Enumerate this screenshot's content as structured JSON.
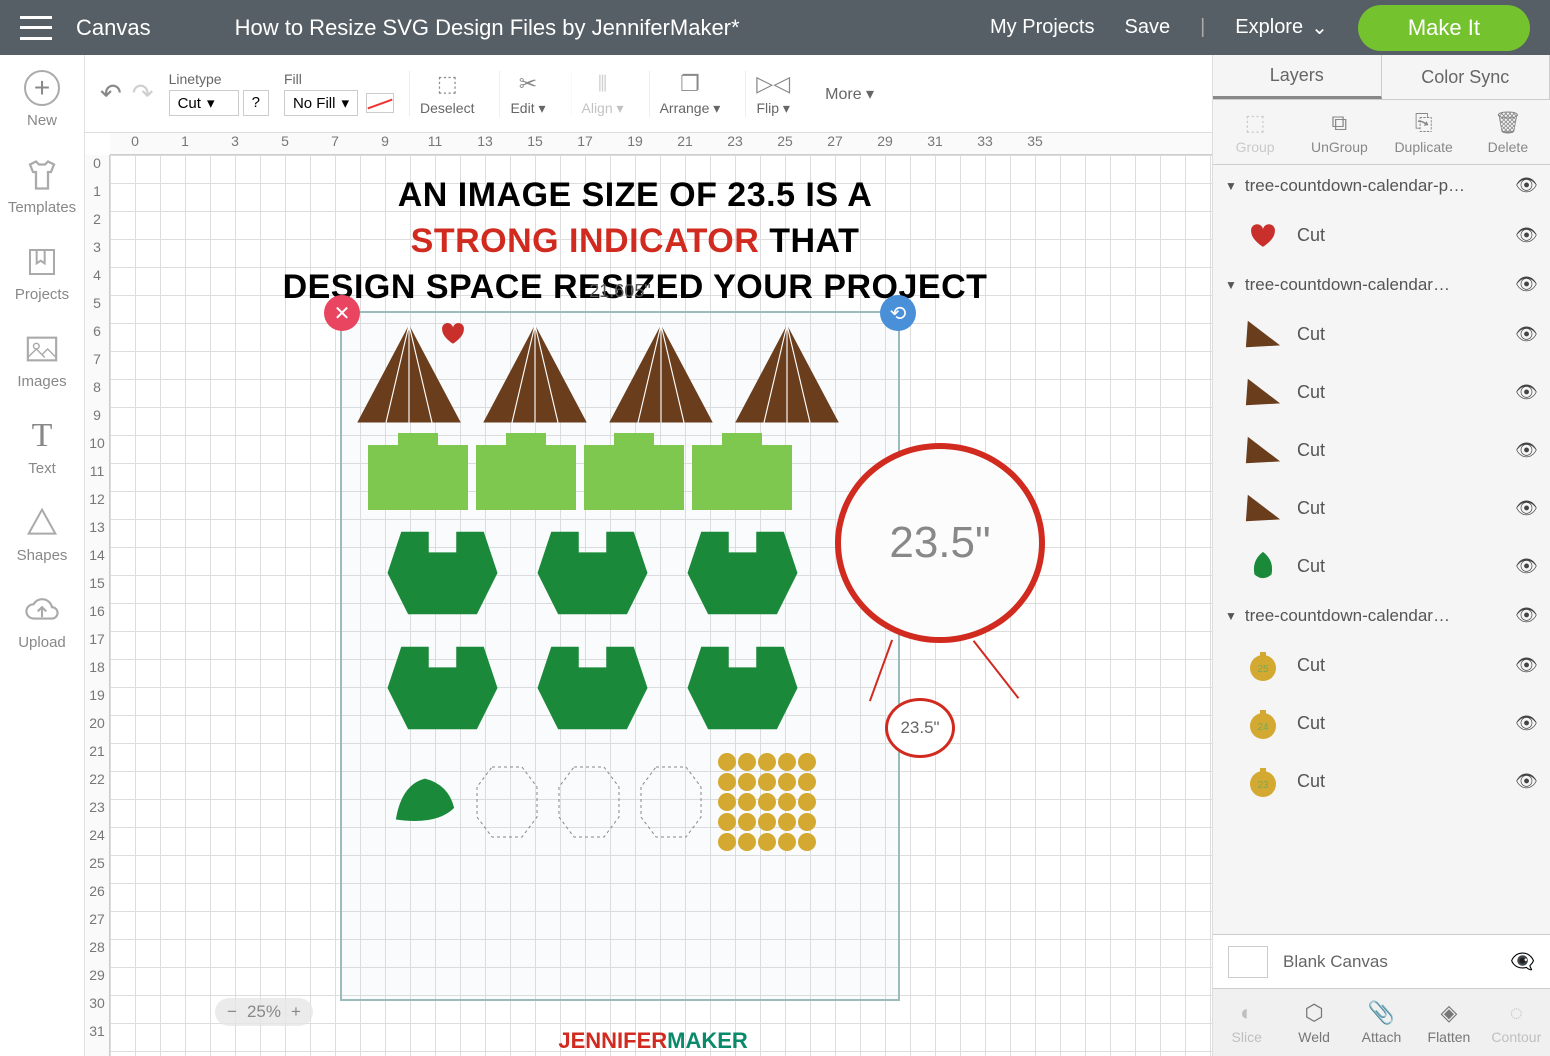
{
  "topbar": {
    "canvas": "Canvas",
    "title": "How to Resize SVG Design Files by JenniferMaker*",
    "myProjects": "My Projects",
    "save": "Save",
    "explore": "Explore",
    "makeIt": "Make It"
  },
  "leftTools": {
    "new": "New",
    "templates": "Templates",
    "projects": "Projects",
    "images": "Images",
    "text": "Text",
    "shapes": "Shapes",
    "upload": "Upload"
  },
  "toolbar": {
    "linetypeLabel": "Linetype",
    "linetype": "Cut",
    "help": "?",
    "fillLabel": "Fill",
    "fill": "No Fill",
    "deselect": "Deselect",
    "edit": "Edit",
    "align": "Align",
    "arrange": "Arrange",
    "flip": "Flip",
    "more": "More"
  },
  "rulerH": [
    "0",
    "1",
    "3",
    "5",
    "7",
    "9",
    "11",
    "13",
    "15",
    "17",
    "19",
    "21",
    "23",
    "25",
    "27",
    "29",
    "31",
    "33",
    "35"
  ],
  "rulerV": [
    "0",
    "1",
    "2",
    "3",
    "4",
    "5",
    "6",
    "7",
    "8",
    "9",
    "10",
    "11",
    "12",
    "13",
    "14",
    "15",
    "16",
    "17",
    "18",
    "19",
    "20",
    "21",
    "22",
    "23",
    "24",
    "25",
    "26",
    "27",
    "28",
    "29",
    "30",
    "31"
  ],
  "selection": {
    "width": "21.605\"",
    "size": "23.5\""
  },
  "annotation": {
    "line1a": "AN IMAGE SIZE OF 23.5 IS A",
    "line2a": "STRONG INDICATOR",
    "line2b": " THAT",
    "line3": "DESIGN SPACE RESIZED YOUR PROJECT"
  },
  "watermark": {
    "j": "JENNIFER",
    "m": "MAKER"
  },
  "zoom": {
    "value": "25%"
  },
  "panel": {
    "layersTab": "Layers",
    "colorSyncTab": "Color Sync",
    "actions": {
      "group": "Group",
      "ungroup": "UnGroup",
      "duplicate": "Duplicate",
      "delete": "Delete"
    },
    "groups": [
      {
        "name": "tree-countdown-calendar-p…",
        "items": [
          {
            "label": "Cut",
            "thumb": "heart",
            "color": "#c9302c"
          }
        ]
      },
      {
        "name": "tree-countdown-calendar…",
        "items": [
          {
            "label": "Cut",
            "thumb": "tri",
            "color": "#6a3d1d"
          },
          {
            "label": "Cut",
            "thumb": "tri",
            "color": "#6a3d1d"
          },
          {
            "label": "Cut",
            "thumb": "tri",
            "color": "#6a3d1d"
          },
          {
            "label": "Cut",
            "thumb": "tri",
            "color": "#6a3d1d"
          },
          {
            "label": "Cut",
            "thumb": "leaf",
            "color": "#1a8a3a"
          }
        ]
      },
      {
        "name": "tree-countdown-calendar…",
        "items": [
          {
            "label": "Cut",
            "thumb": "coin",
            "color": "#d4a932",
            "text": "25"
          },
          {
            "label": "Cut",
            "thumb": "coin",
            "color": "#d4a932",
            "text": "24"
          },
          {
            "label": "Cut",
            "thumb": "coin",
            "color": "#d4a932",
            "text": "23"
          }
        ]
      }
    ],
    "blankCanvas": "Blank Canvas",
    "bottomActions": {
      "slice": "Slice",
      "weld": "Weld",
      "attach": "Attach",
      "flatten": "Flatten",
      "contour": "Contour"
    }
  }
}
